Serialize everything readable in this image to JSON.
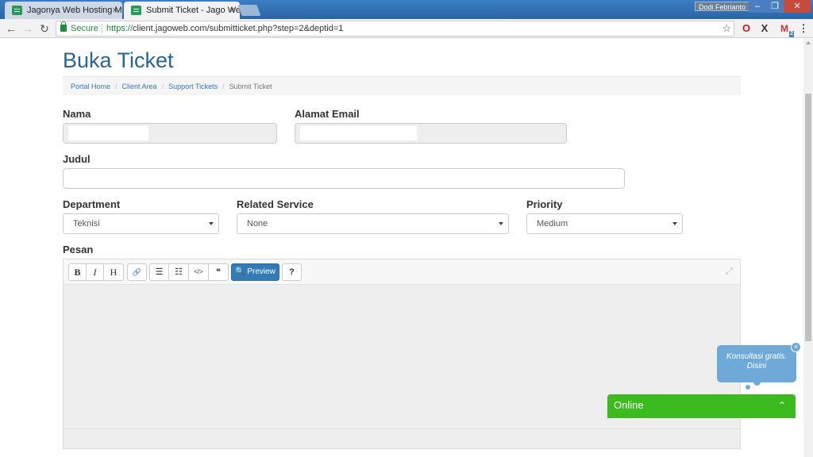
{
  "browser": {
    "tabs": [
      {
        "title": "Jagonya Web Hosting M",
        "close": "×"
      },
      {
        "title": "Submit Ticket - Jago Web",
        "close": "×"
      }
    ],
    "user": "Dodi Febrianto",
    "window_buttons": {
      "minimize": "–",
      "maximize": "❐",
      "close": "✕"
    },
    "nav": {
      "back": "←",
      "forward": "→",
      "reload": "↻"
    },
    "secure_label": "Secure",
    "url_scheme": "https://",
    "url_rest": "client.jagoweb.com/submitticket.php?step=2&deptid=1",
    "bookmark_star": "☆",
    "extensions": {
      "opera": "O",
      "x": "X",
      "gmail": "M",
      "gmail_badge": "2",
      "menu": "⋮"
    }
  },
  "page": {
    "title": "Buka Ticket",
    "breadcrumb": [
      {
        "label": "Portal Home"
      },
      {
        "label": "Client Area"
      },
      {
        "label": "Support Tickets"
      },
      {
        "label": "Submit Ticket"
      }
    ],
    "breadcrumb_separator": "/"
  },
  "form": {
    "nama_label": "Nama",
    "email_label": "Alamat Email",
    "judul_label": "Judul",
    "department_label": "Department",
    "department_value": "Teknisi",
    "related_label": "Related Service",
    "related_value": "None",
    "priority_label": "Priority",
    "priority_value": "Medium",
    "pesan_label": "Pesan"
  },
  "editor": {
    "toolbar": {
      "bold": "B",
      "italic": "I",
      "heading": "H",
      "link": "🔗",
      "ul": "☰",
      "ol": "☷",
      "code": "</>",
      "quote": "❝",
      "preview": "🔍 Preview",
      "help": "?"
    },
    "expand": "⤢"
  },
  "chat": {
    "bubble_text": "Konsultasi gratis. Disini",
    "close": "×",
    "status": "Online",
    "toggle": "⌃"
  }
}
